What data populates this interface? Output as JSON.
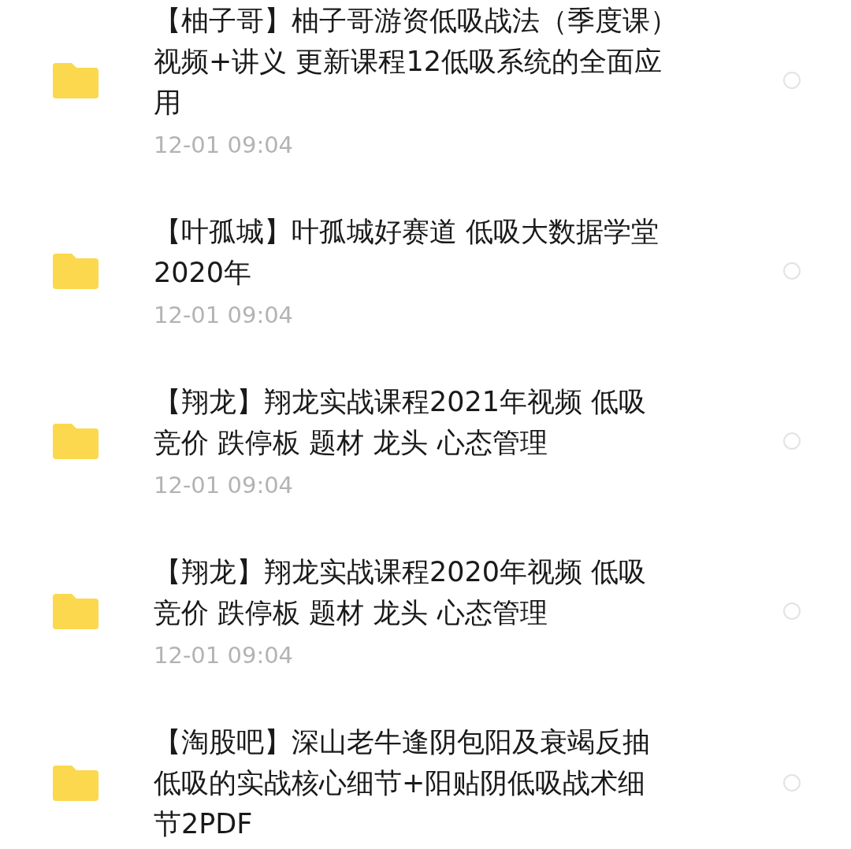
{
  "files": [
    {
      "title_lines": [
        "【柚子哥】柚子哥游资低吸战法（季度课）",
        "视频+讲义 更新课程12低吸系统的全面应",
        "用"
      ],
      "date": "12-01  09:04",
      "selected": false
    },
    {
      "title_lines": [
        "【叶孤城】叶孤城好赛道 低吸大数据学堂",
        "2020年"
      ],
      "date": "12-01  09:04",
      "selected": false
    },
    {
      "title_lines": [
        "【翔龙】翔龙实战课程2021年视频 低吸",
        "竞价 跌停板 题材 龙头 心态管理"
      ],
      "date": "12-01  09:04",
      "selected": false
    },
    {
      "title_lines": [
        "【翔龙】翔龙实战课程2020年视频 低吸",
        "竞价 跌停板 题材 龙头 心态管理"
      ],
      "date": "12-01  09:04",
      "selected": false
    },
    {
      "title_lines": [
        "【淘股吧】深山老牛逢阴包阳及衰竭反抽",
        "低吸的实战核心细节+阳贴阴低吸战术细",
        "节2PDF"
      ],
      "selected": false
    }
  ]
}
